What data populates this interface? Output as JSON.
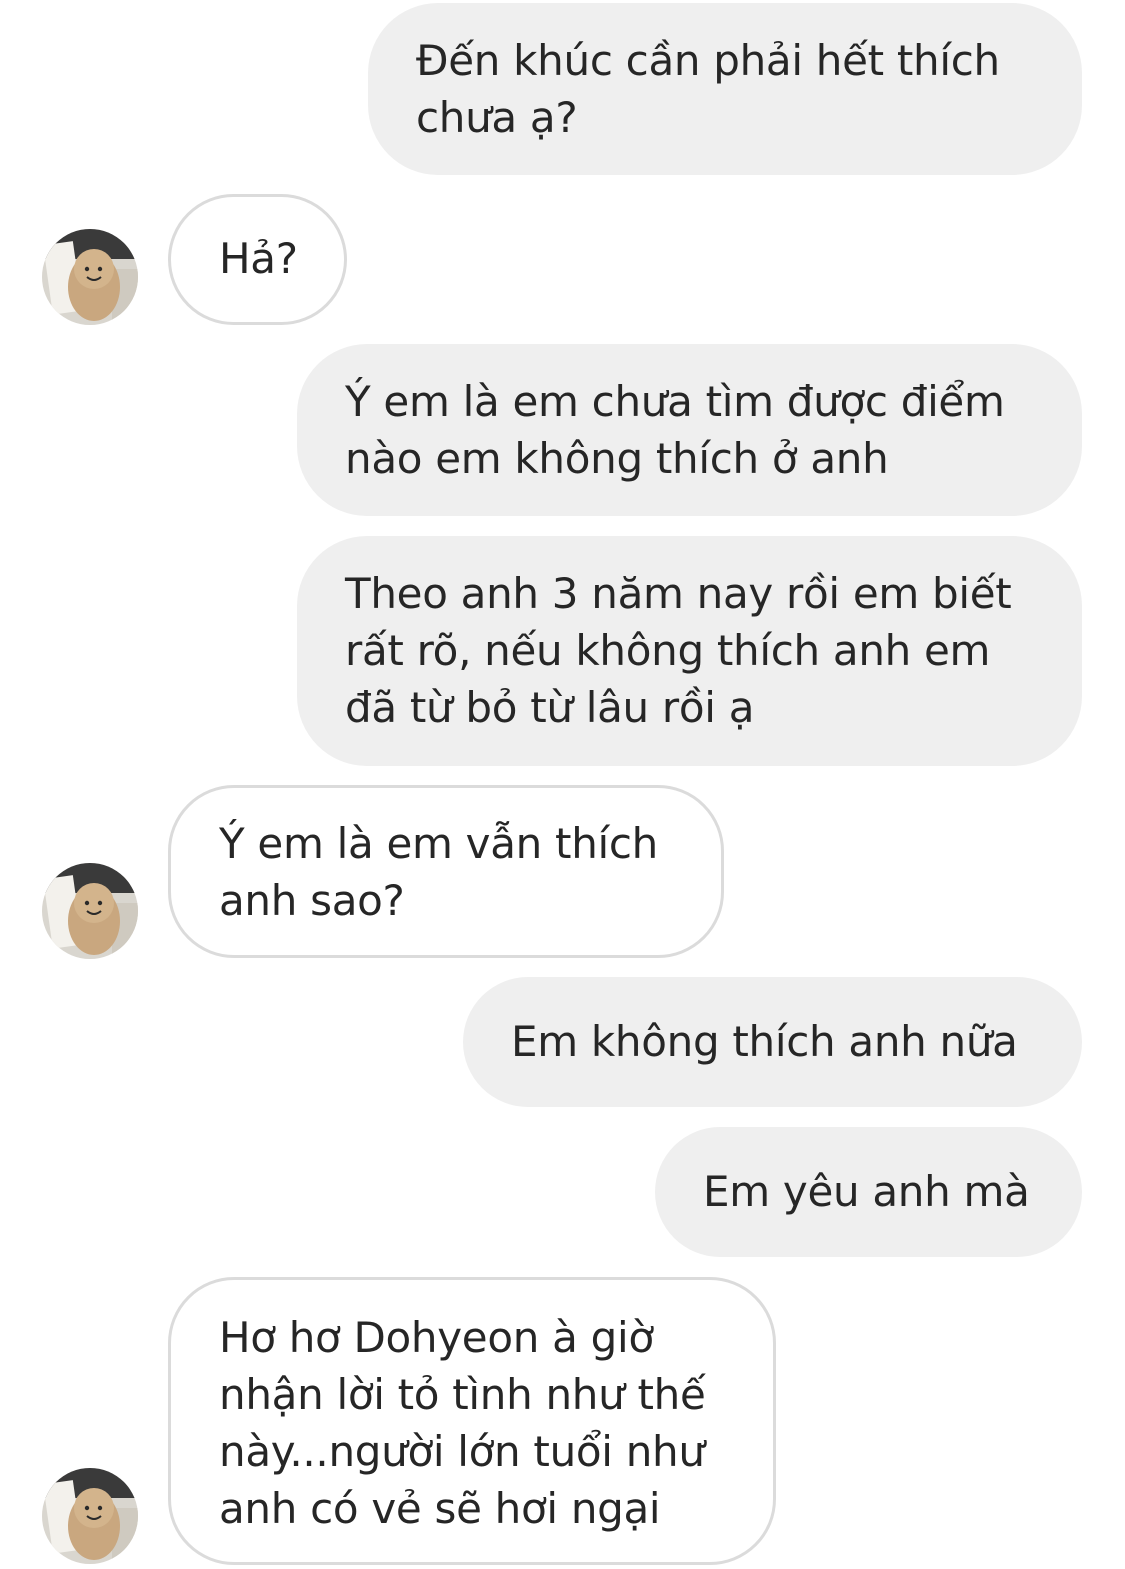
{
  "conversation": {
    "messages": [
      {
        "from": "me",
        "text": "Đến khúc cần phải hết thích\nchưa ạ?"
      },
      {
        "from": "them",
        "text": "Hả?"
      },
      {
        "from": "me",
        "text": "Ý em là em chưa tìm được điểm\nnào em không thích ở anh"
      },
      {
        "from": "me",
        "text": "Theo anh 3 năm nay rồi em biết\nrất rõ, nếu không thích anh em\nđã từ bỏ từ lâu rồi ạ"
      },
      {
        "from": "them",
        "text": "Ý em là em vẫn thích\nanh sao?"
      },
      {
        "from": "me",
        "text": "Em không thích anh nữa"
      },
      {
        "from": "me",
        "text": "Em yêu anh mà"
      },
      {
        "from": "them",
        "text": "Hơ hơ Dohyeon à giờ\nnhận lời tỏ tình như thế\nnày...người lớn tuổi như\nanh có vẻ sẽ hơi ngại"
      }
    ]
  },
  "avatar": {
    "icon": "plush-peanut-avatar-icon"
  },
  "colors": {
    "sent_bubble": "#efefef",
    "received_border": "#dbdbdb",
    "text": "#262626",
    "background": "#ffffff"
  }
}
